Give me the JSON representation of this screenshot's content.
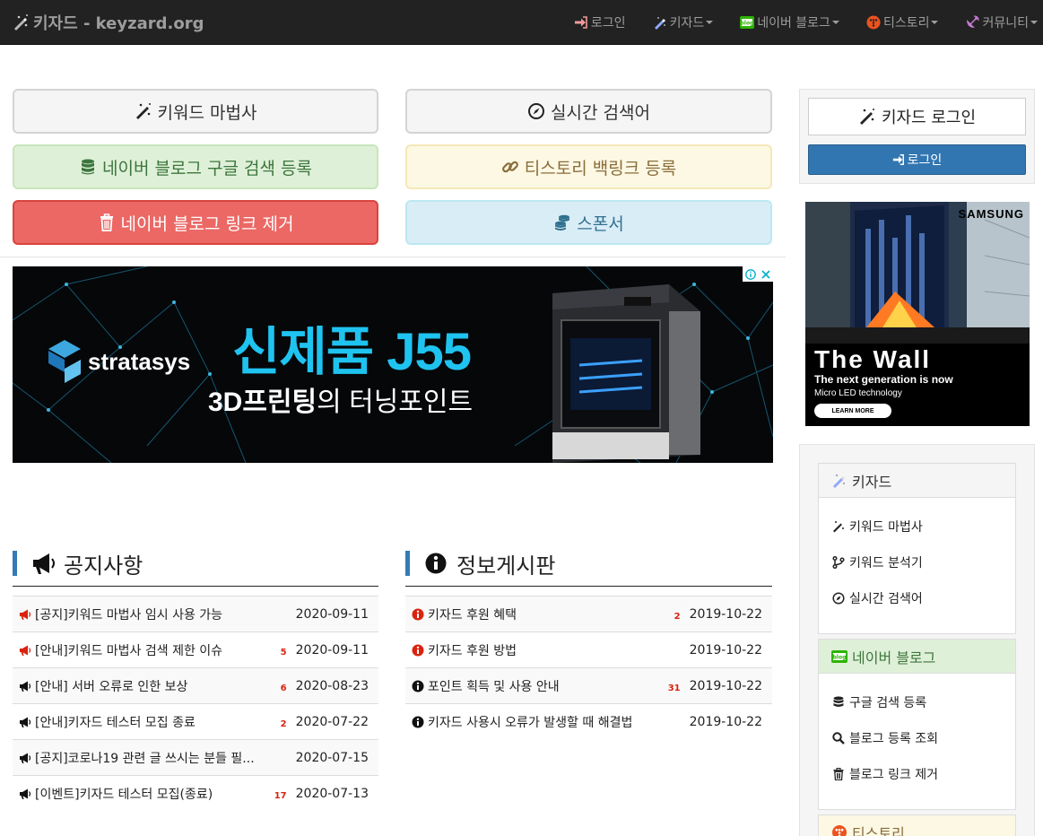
{
  "brand": {
    "title": "키자드 - keyzard.org"
  },
  "nav": {
    "login": "로그인",
    "keyzard": "키자드",
    "naver_blog": "네이버 블로그",
    "tistory": "티스토리",
    "community": "커뮤니티"
  },
  "buttons": {
    "keyword_wizard": "키워드 마법사",
    "realtime_search": "실시간 검색어",
    "naver_google_register": "네이버 블로그 구글 검색 등록",
    "tistory_backlink": "티스토리 백링크 등록",
    "naver_link_remove": "네이버 블로그 링크 제거",
    "sponsor": "스폰서"
  },
  "ad_main": {
    "brand": "stratasys",
    "headline": "신제품 J55",
    "sub_bold": "3D프린팅",
    "sub_rest": "의 터닝포인트"
  },
  "notice": {
    "title": "공지사항",
    "rows": [
      {
        "text": "[공지]키워드 마법사 임시 사용 가능",
        "count": "",
        "date": "2020-09-11",
        "highlight": true
      },
      {
        "text": "[안내]키워드 마법사 검색 제한 이슈",
        "count": "5",
        "date": "2020-09-11",
        "highlight": true
      },
      {
        "text": "[안내] 서버 오류로 인한 보상",
        "count": "6",
        "date": "2020-08-23",
        "highlight": false
      },
      {
        "text": "[안내]키자드 테스터 모집 종료",
        "count": "2",
        "date": "2020-07-22",
        "highlight": false
      },
      {
        "text": "[공지]코로나19 관련 글 쓰시는 분들 필...",
        "count": "",
        "date": "2020-07-15",
        "highlight": false
      },
      {
        "text": "[이벤트]키자드 테스터 모집(종료)",
        "count": "17",
        "date": "2020-07-13",
        "highlight": false
      }
    ]
  },
  "info": {
    "title": "정보게시판",
    "rows": [
      {
        "text": "키자드 후원 혜택",
        "count": "2",
        "date": "2019-10-22",
        "highlight": true
      },
      {
        "text": "키자드 후원 방법",
        "count": "",
        "date": "2019-10-22",
        "highlight": true
      },
      {
        "text": "포인트 획득 및 사용 안내",
        "count": "31",
        "date": "2019-10-22",
        "highlight": false
      },
      {
        "text": "키자드 사용시 오류가 발생할 때 해결법",
        "count": "",
        "date": "2019-10-22",
        "highlight": false
      }
    ]
  },
  "sidebar": {
    "login_title": "키자드 로그인",
    "login_button": "로그인",
    "ad": {
      "brand": "SAMSUNG",
      "headline": "The Wall",
      "line1": "The next generation is now",
      "line2": "Micro LED technology",
      "cta": "LEARN MORE"
    },
    "menus": [
      {
        "title": "키자드",
        "items": [
          "키워드 마법사",
          "키워드 분석기",
          "실시간 검색어"
        ]
      },
      {
        "title": "네이버 블로그",
        "items": [
          "구글 검색 등록",
          "블로그 등록 조회",
          "블로그 링크 제거"
        ]
      },
      {
        "title": "티스토리",
        "items": []
      }
    ]
  },
  "colors": {
    "navbar": "#222222",
    "primary": "#3276b1",
    "danger": "#eb6864",
    "count_red": "#d9230f"
  }
}
